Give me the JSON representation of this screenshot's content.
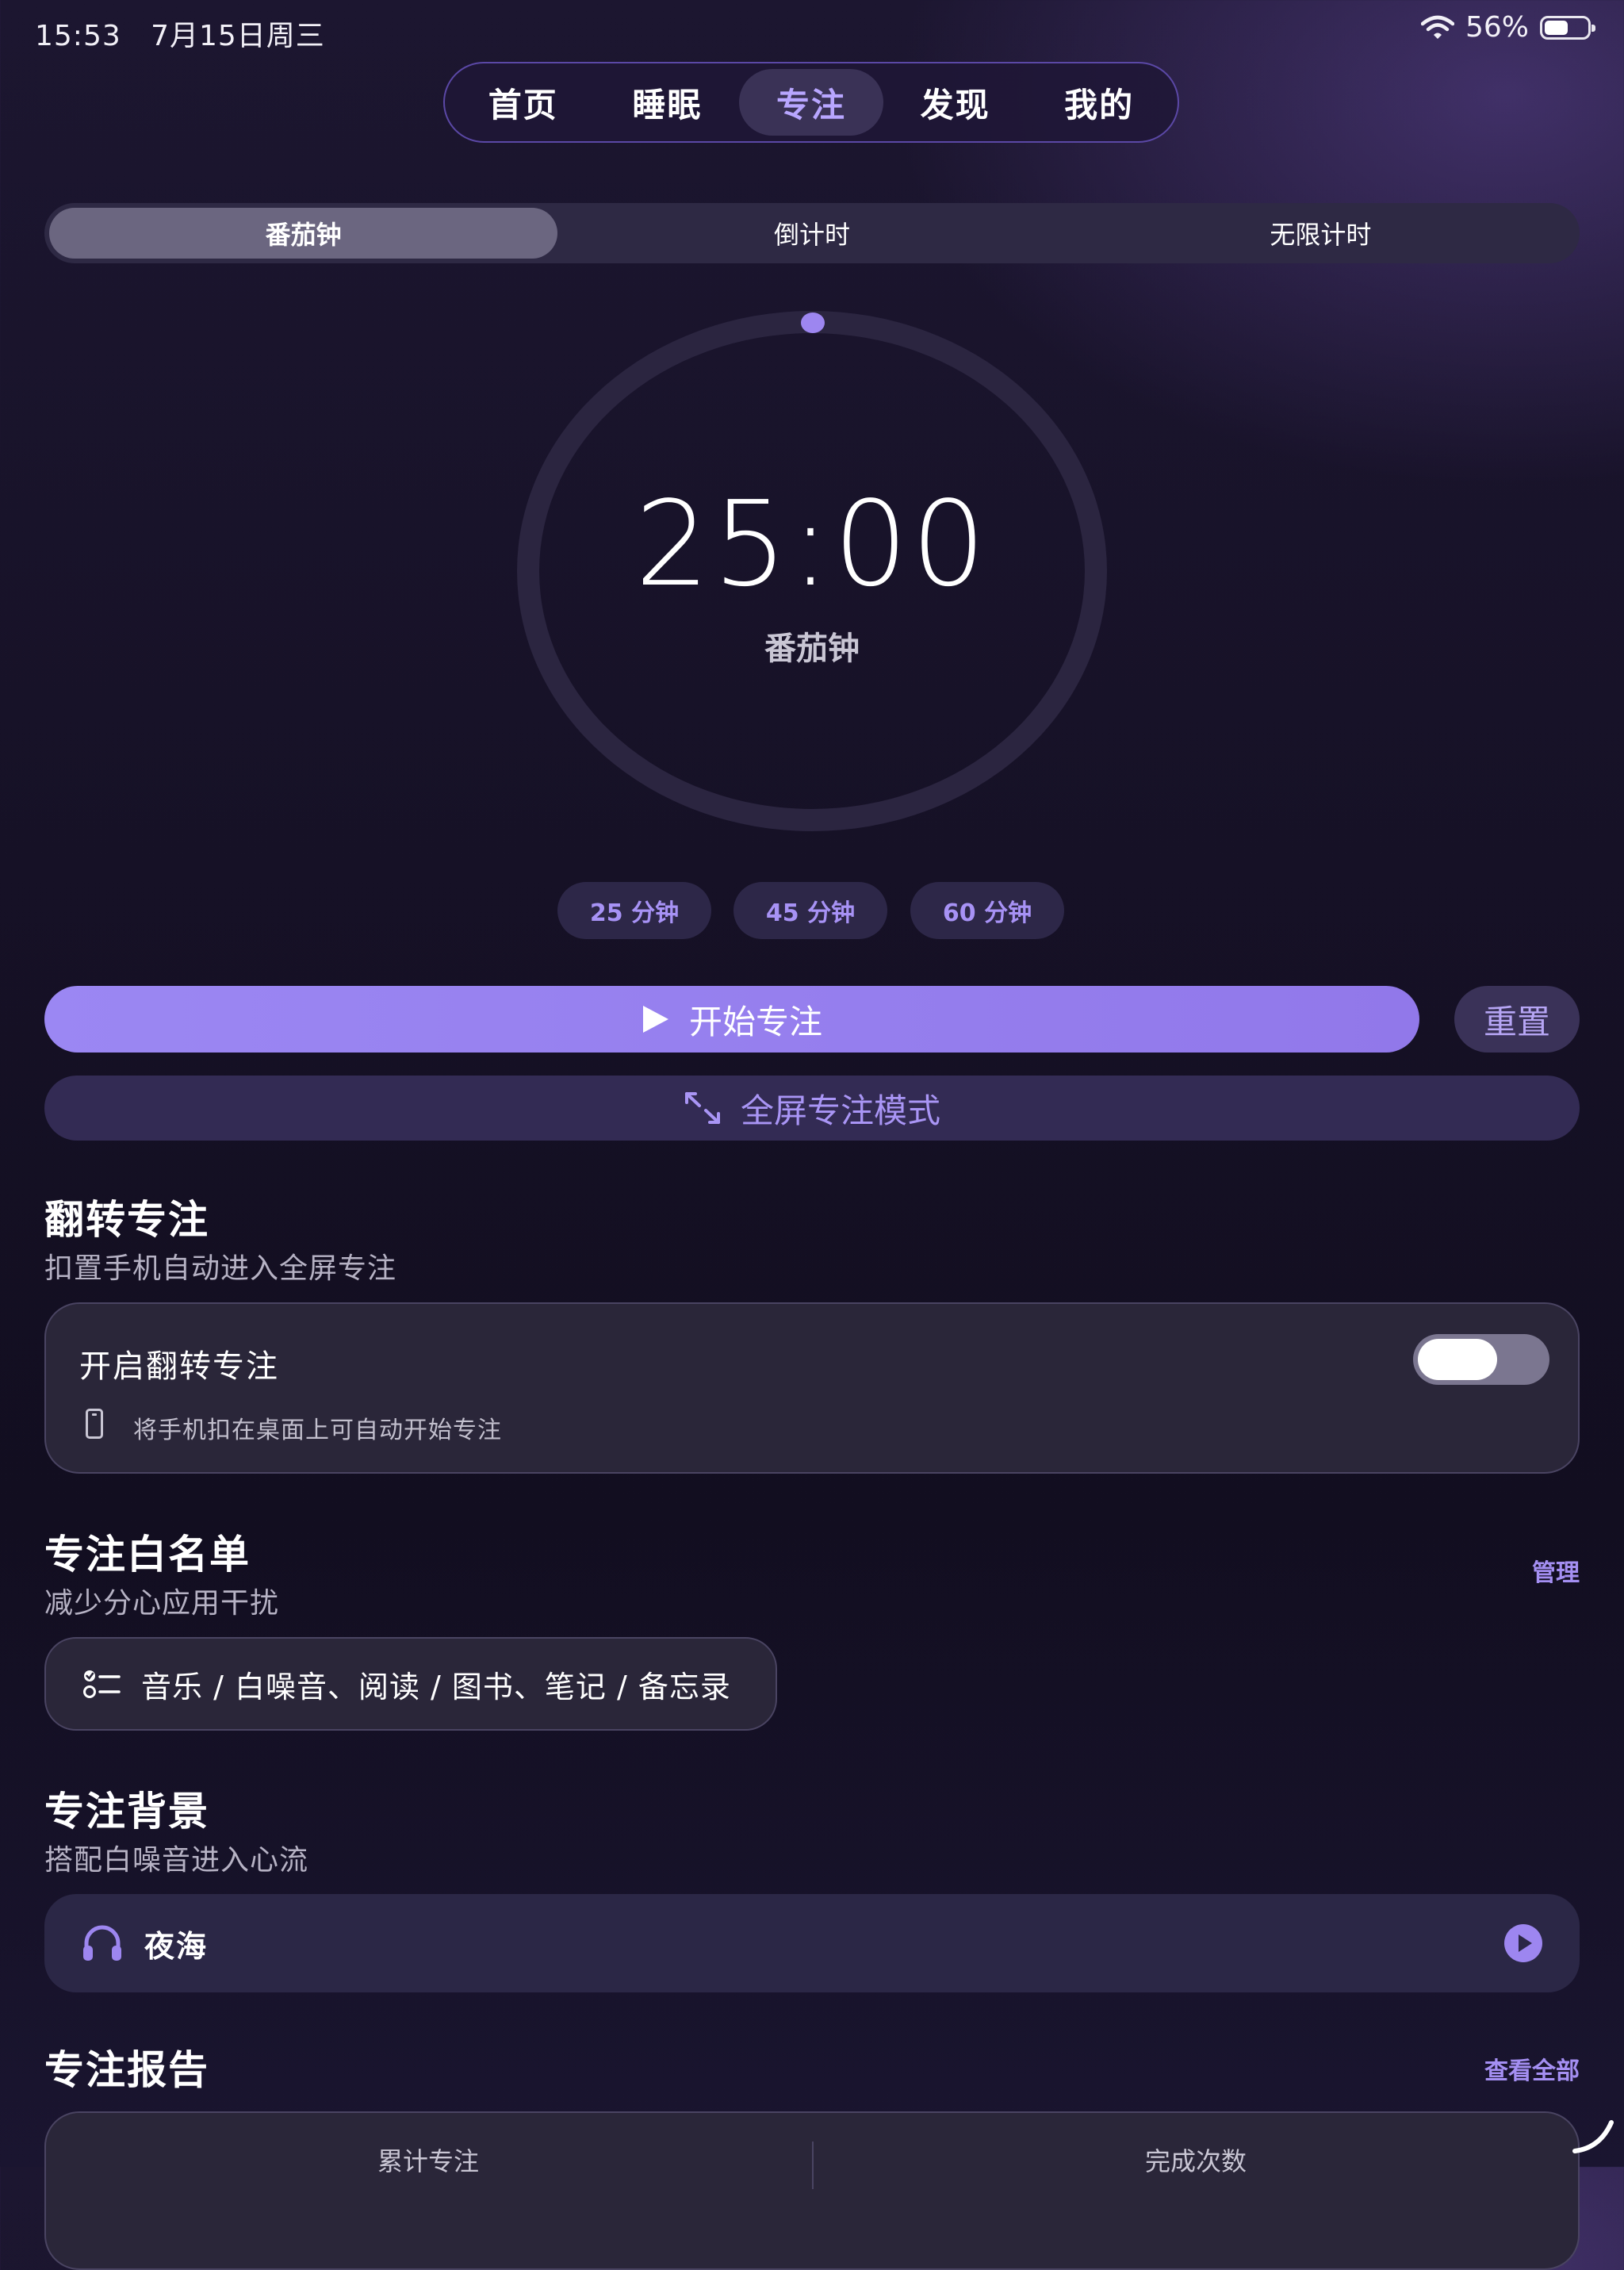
{
  "status_bar": {
    "time": "15:53",
    "date": "7月15日周三",
    "battery": "56%",
    "battery_level": 0.56
  },
  "nav": {
    "tabs": [
      "首页",
      "睡眠",
      "专注",
      "发现",
      "我的"
    ],
    "active_index": 2
  },
  "mode_tabs": {
    "items": [
      "番茄钟",
      "倒计时",
      "无限计时"
    ],
    "active_index": 0
  },
  "timer": {
    "value": "25:00",
    "label": "番茄钟",
    "progress": 0
  },
  "presets": [
    "25 分钟",
    "45 分钟",
    "60 分钟"
  ],
  "actions": {
    "start": "开始专注",
    "reset": "重置",
    "fullscreen": "全屏专注模式"
  },
  "flip": {
    "title": "翻转专注",
    "subtitle": "扣置手机自动进入全屏专注",
    "toggle_label": "开启翻转专注",
    "toggle_on": true,
    "hint": "将手机扣在桌面上可自动开始专注"
  },
  "whitelist": {
    "title": "专注白名单",
    "subtitle": "减少分心应用干扰",
    "manage": "管理",
    "apps": "音乐 / 白噪音、阅读 / 图书、笔记 / 备忘录"
  },
  "background": {
    "title": "专注背景",
    "subtitle": "搭配白噪音进入心流",
    "track": "夜海"
  },
  "report": {
    "title": "专注报告",
    "view_all": "查看全部",
    "col1": "累计专注",
    "col2": "完成次数"
  },
  "colors": {
    "accent": "#9b87f3",
    "accent_text": "#a792f5",
    "bg": "#161126",
    "card": "#2a2639"
  }
}
